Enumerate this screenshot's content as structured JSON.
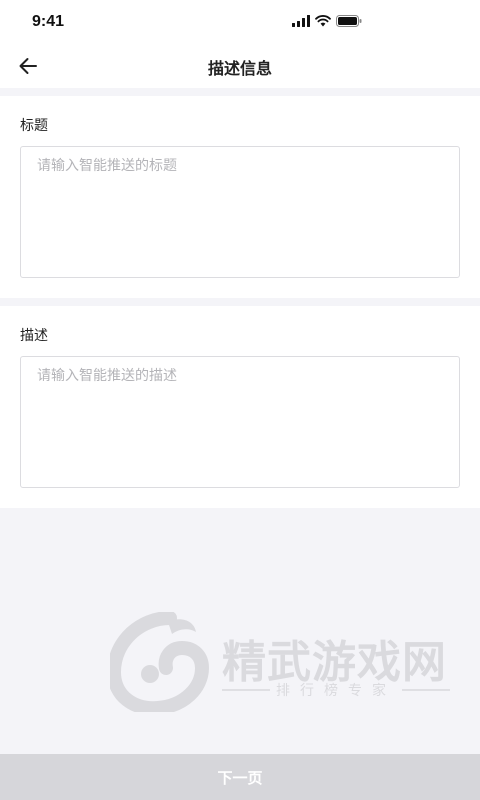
{
  "status_bar": {
    "time": "9:41"
  },
  "nav": {
    "title": "描述信息"
  },
  "title_section": {
    "label": "标题",
    "placeholder": "请输入智能推送的标题",
    "value": ""
  },
  "desc_section": {
    "label": "描述",
    "placeholder": "请输入智能推送的描述",
    "value": ""
  },
  "watermark": {
    "title": "精武游戏网",
    "subtitle": "排行榜专家"
  },
  "footer": {
    "next_label": "下一页"
  },
  "icons": {
    "back": "arrow-left-icon",
    "signal": "signal-bars-icon",
    "wifi": "wifi-icon",
    "battery": "battery-icon"
  },
  "colors": {
    "background": "#f4f4f8",
    "next_button_bg": "#d6d6da",
    "placeholder": "#b4b4b8"
  }
}
